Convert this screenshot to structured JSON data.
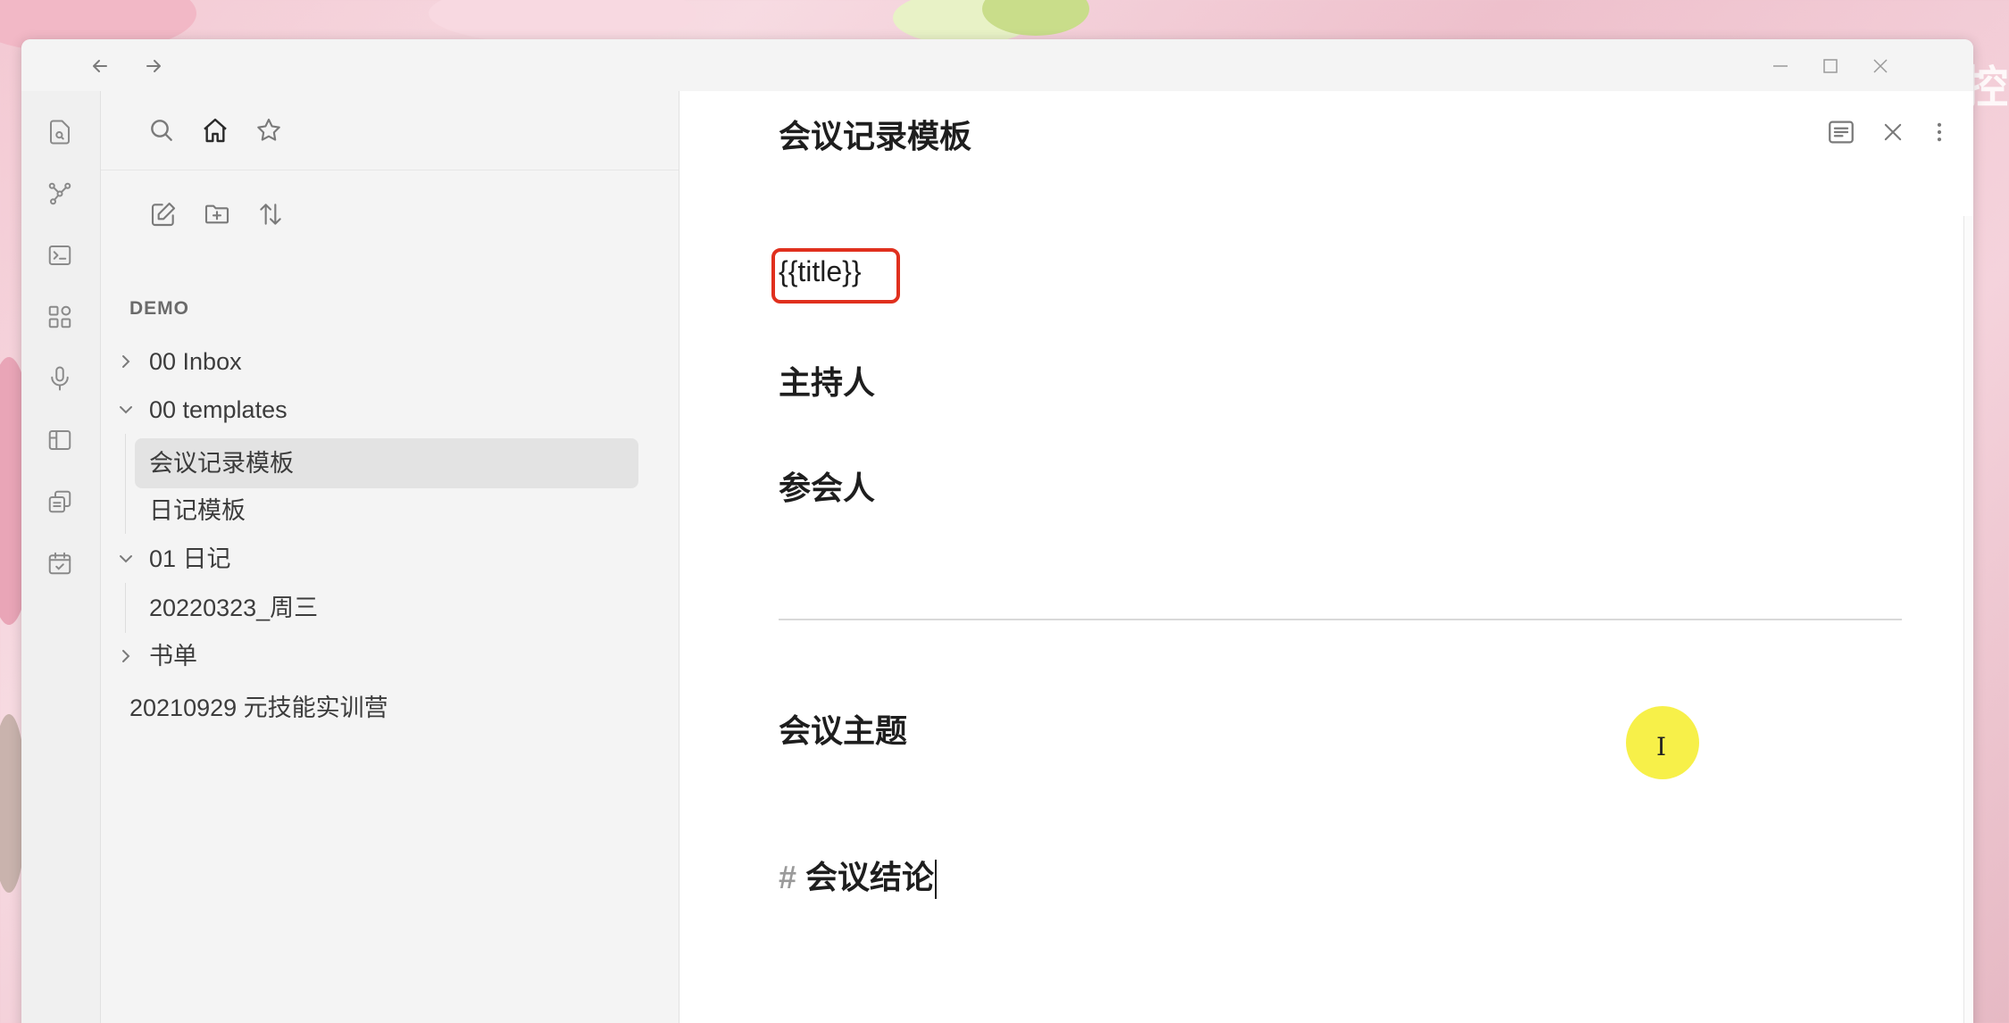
{
  "titlebar": {
    "back_icon": "arrow-left-icon",
    "forward_icon": "arrow-right-icon",
    "minimize_icon": "minimize-icon",
    "maximize_icon": "maximize-icon",
    "close_icon": "close-icon"
  },
  "watermark": "涛的控",
  "ribbon": {
    "icons": [
      "quick-switcher-icon",
      "graph-view-icon",
      "command-palette-icon",
      "apps-icon",
      "microphone-icon",
      "canvas-icon",
      "copy-icon",
      "calendar-check-icon"
    ],
    "bottom_icon": "vault-profile-icon"
  },
  "sidebar": {
    "top_icons": [
      "search-icon",
      "home-icon",
      "star-icon"
    ],
    "action_icons": [
      "new-note-icon",
      "new-folder-icon",
      "sort-icon"
    ],
    "vault_name": "DEMO",
    "tree": [
      {
        "label": "00 Inbox",
        "type": "folder",
        "expanded": false,
        "level": 0
      },
      {
        "label": "00 templates",
        "type": "folder",
        "expanded": true,
        "level": 0
      },
      {
        "label": "会议记录模板",
        "type": "file",
        "active": true,
        "level": 1
      },
      {
        "label": "日记模板",
        "type": "file",
        "level": 1
      },
      {
        "label": "01 日记",
        "type": "folder",
        "expanded": true,
        "level": 0
      },
      {
        "label": "20220323_周三",
        "type": "file",
        "level": 1
      },
      {
        "label": "书单",
        "type": "folder",
        "expanded": false,
        "level": 0
      },
      {
        "label": "20210929 元技能实训营",
        "type": "file",
        "level": 0
      }
    ]
  },
  "editor": {
    "title": "会议记录模板",
    "header_icons": [
      "reading-view-icon",
      "close-icon",
      "more-options-icon"
    ],
    "lines": {
      "title_placeholder": "{{title}}",
      "host": "主持人",
      "attendees": "参会人",
      "topic": "会议主题",
      "conclusion_hash": "#",
      "conclusion": "会议结论"
    },
    "cursor_glyph": "I"
  },
  "colors": {
    "highlight_border": "#e0301e",
    "cursor_highlight": "#f6ef3a",
    "active_row": "#e3e3e3"
  }
}
